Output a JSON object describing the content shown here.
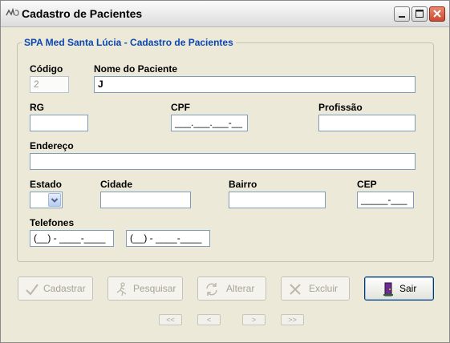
{
  "window": {
    "title": "Cadastro de Pacientes",
    "icon": "app-icon"
  },
  "form": {
    "group_title": "SPA Med Santa Lúcia - Cadastro de Pacientes",
    "labels": {
      "codigo": "Código",
      "nome": "Nome do Paciente",
      "rg": "RG",
      "cpf": "CPF",
      "profissao": "Profissão",
      "endereco": "Endereço",
      "estado": "Estado",
      "cidade": "Cidade",
      "bairro": "Bairro",
      "cep": "CEP",
      "telefones": "Telefones"
    },
    "values": {
      "codigo": "2",
      "nome": "J",
      "rg": "",
      "cpf": "___.___.___-__",
      "profissao": "",
      "endereco": "",
      "estado": "",
      "cidade": "",
      "bairro": "",
      "cep": "_____-___",
      "telefone1": "(__) - ____-____",
      "telefone2": "(__) - ____-____"
    }
  },
  "buttons": {
    "cadastrar": "Cadastrar",
    "pesquisar": "Pesquisar",
    "alterar": "Alterar",
    "excluir": "Excluir",
    "sair": "Sair"
  },
  "navigation": {
    "first": "<<",
    "prev": "<",
    "next": ">",
    "last": ">>"
  }
}
